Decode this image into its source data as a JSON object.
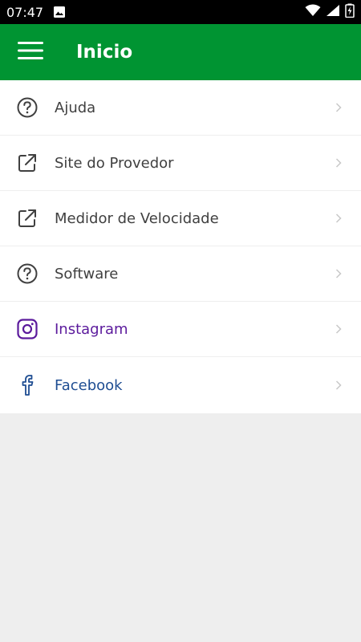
{
  "status_bar": {
    "time": "07:47",
    "icons": [
      "image-icon",
      "wifi-icon",
      "signal-icon",
      "battery-icon"
    ]
  },
  "app_bar": {
    "title": "Inicio",
    "menu_icon": "hamburger-menu-icon",
    "background": "#009432"
  },
  "menu": {
    "items": [
      {
        "label": "Ajuda",
        "icon": "help-circle-icon",
        "color": "#404040"
      },
      {
        "label": "Site do Provedor",
        "icon": "external-link-icon",
        "color": "#404040"
      },
      {
        "label": "Medidor de Velocidade",
        "icon": "external-link-icon",
        "color": "#404040"
      },
      {
        "label": "Software",
        "icon": "help-circle-icon",
        "color": "#404040"
      },
      {
        "label": "Instagram",
        "icon": "instagram-icon",
        "color": "#5b1a9c"
      },
      {
        "label": "Facebook",
        "icon": "facebook-icon",
        "color": "#1e4d92"
      }
    ],
    "chevron_icon": "chevron-right-icon"
  }
}
